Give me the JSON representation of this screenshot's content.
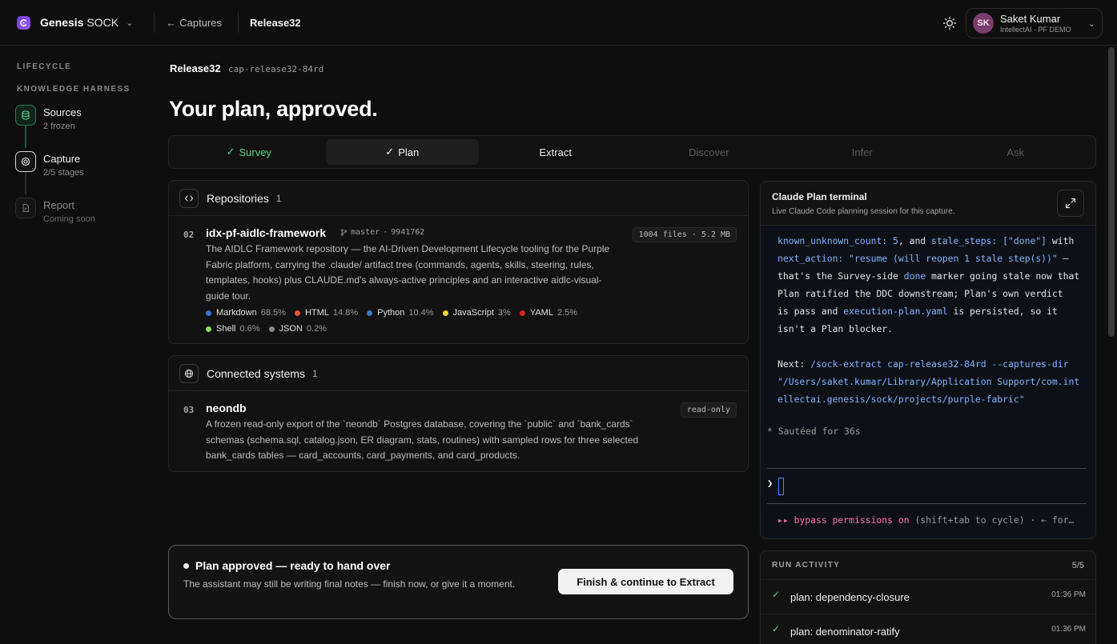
{
  "app": {
    "brand_bold": "Genesis",
    "brand_light": "SOCK"
  },
  "topbar": {
    "back_label": "Captures",
    "crumb": "Release32"
  },
  "user": {
    "initials": "SK",
    "name": "Saket Kumar",
    "org": "IntellectAI · PF DEMO",
    "avatar_color": "#7a3d6b"
  },
  "nav": {
    "lifecycle_label": "LIFECYCLE",
    "harness_label": "KNOWLEDGE HARNESS",
    "steps": [
      {
        "title": "Sources",
        "sub": "2 frozen",
        "state": "done"
      },
      {
        "title": "Capture",
        "sub": "2/5 stages",
        "state": "active"
      },
      {
        "title": "Report",
        "sub": "Coming soon",
        "state": "disabled"
      }
    ]
  },
  "release": {
    "name": "Release32",
    "id": "cap-release32-84rd"
  },
  "page_title": "Your plan, approved.",
  "tabs": [
    {
      "label": "Survey",
      "state": "done"
    },
    {
      "label": "Plan",
      "state": "active"
    },
    {
      "label": "Extract",
      "state": "next"
    },
    {
      "label": "Discover",
      "state": "disabled"
    },
    {
      "label": "Infer",
      "state": "disabled"
    },
    {
      "label": "Ask",
      "state": "disabled"
    }
  ],
  "repositories": {
    "title": "Repositories",
    "count": "1",
    "item": {
      "num": "02",
      "name": "idx-pf-aidlc-framework",
      "branch": "master",
      "commit": "9941762",
      "stats": "1004 files · 5.2 MB",
      "desc_lines": [
        "The AIDLC Framework repository — the AI-Driven Development Lifecycle tooling for the Purple",
        "Fabric platform, carrying the .claude/ artifact tree (commands, agents, skills, steering, rules,",
        "templates, hooks) plus CLAUDE.md's always-active principles and an interactive aidlc-visual-",
        "guide tour."
      ],
      "languages": [
        {
          "name": "Markdown",
          "pct": "68.5%",
          "color": "#3b6fd6"
        },
        {
          "name": "HTML",
          "pct": "14.8%",
          "color": "#e4572e"
        },
        {
          "name": "Python",
          "pct": "10.4%",
          "color": "#3d7cc9"
        },
        {
          "name": "JavaScript",
          "pct": "3%",
          "color": "#f0d83a"
        },
        {
          "name": "YAML",
          "pct": "2.5%",
          "color": "#d6252b"
        },
        {
          "name": "Shell",
          "pct": "0.6%",
          "color": "#8fde5a"
        },
        {
          "name": "JSON",
          "pct": "0.2%",
          "color": "#8a8a8a"
        }
      ]
    }
  },
  "connected": {
    "title": "Connected systems",
    "count": "1",
    "item": {
      "num": "03",
      "name": "neondb",
      "badge": "read-only",
      "desc_lines": [
        "A frozen read-only export of the `neondb` Postgres database, covering the `public` and `bank_cards`",
        "schemas (schema.sql, catalog.json, ER diagram, stats, routines) with sampled rows for three selected",
        "bank_cards tables — card_accounts, card_payments, and card_products."
      ]
    }
  },
  "approval": {
    "title": "Plan approved — ready to hand over",
    "desc": "The assistant may still be writing final notes — finish now, or give it a moment.",
    "button": "Finish & continue to Extract"
  },
  "terminal": {
    "title": "Claude Plan terminal",
    "subtitle": "Live Claude Code planning session for this capture.",
    "l1a": "known_unknown_count: ",
    "l1b": "5",
    "l1c": ", and ",
    "l1d": "stale_steps: [\"done\"]",
    "l1e": " with",
    "l2a": "next_action: \"resume (will reopen 1 stale step(s))\"",
    "l2b": " —",
    "l3a": "that's the Survey-side ",
    "l3b": "done",
    "l3c": " marker going stale now that",
    "l4": "Plan ratified the DDC downstream; Plan's own verdict",
    "l5a": "is pass and ",
    "l5b": "execution-plan.yaml",
    "l5c": " is persisted, so it",
    "l6": "isn't a Plan blocker.",
    "next_label": "Next: ",
    "next_cmd": "/sock-extract cap-release32-84rd --captures-dir",
    "next_path1": "\"/Users/saket.kumar/Library/Application Support/com.int",
    "next_path2": "ellectai.genesis/sock/projects/purple-fabric\"",
    "sauteed": "* Sautéed for 36s",
    "prompt": "❯",
    "bypass_a": "▸▸ bypass permissions on",
    "bypass_b": " (shift+tab to cycle) · ← for…"
  },
  "run_activity": {
    "title": "RUN ACTIVITY",
    "count": "5/5",
    "items": [
      {
        "label": "plan: dependency-closure",
        "time": "01:36 PM"
      },
      {
        "label": "plan: denominator-ratify",
        "time": "01:36 PM"
      }
    ]
  }
}
